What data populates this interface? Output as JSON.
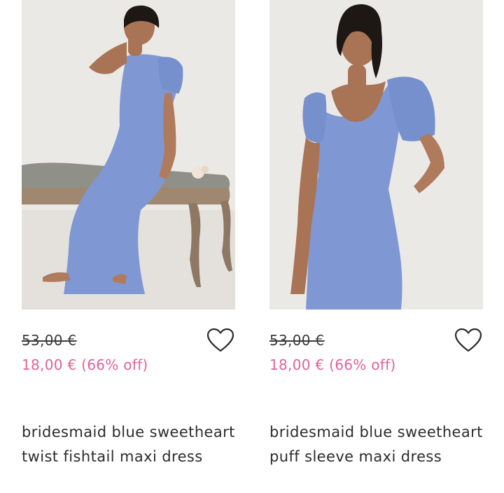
{
  "products": [
    {
      "original_price": "53,00 €",
      "sale_price": "18,00 € (66% off)",
      "title": "bridesmaid blue sweetheart twist fishtail maxi dress",
      "image_subject": "model-seated-bench",
      "wishlist_icon": "heart-outline-icon"
    },
    {
      "original_price": "53,00 €",
      "sale_price": "18,00 € (66% off)",
      "title": "bridesmaid blue sweetheart puff sleeve maxi dress",
      "image_subject": "model-standing",
      "wishlist_icon": "heart-outline-icon"
    }
  ],
  "colors": {
    "sale_price": "#e0629a",
    "dress_blue": "#7f98d4",
    "text": "#2c2c2c"
  }
}
